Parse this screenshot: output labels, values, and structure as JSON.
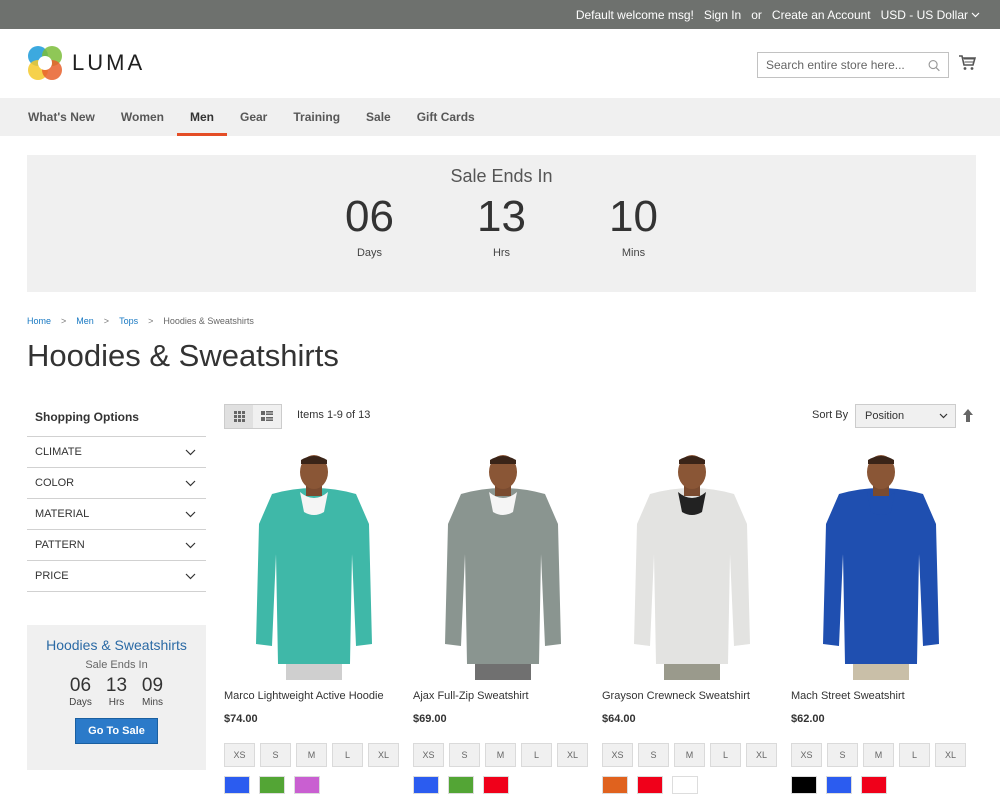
{
  "topbar": {
    "welcome": "Default welcome msg!",
    "sign_in": "Sign In",
    "or": "or",
    "create_account": "Create an Account",
    "currency": "USD - US Dollar"
  },
  "header": {
    "logo_text": "LUMA",
    "search_placeholder": "Search entire store here..."
  },
  "nav": {
    "items": [
      {
        "label": "What's New"
      },
      {
        "label": "Women"
      },
      {
        "label": "Men",
        "active": true
      },
      {
        "label": "Gear"
      },
      {
        "label": "Training"
      },
      {
        "label": "Sale"
      },
      {
        "label": "Gift Cards"
      }
    ]
  },
  "banner": {
    "title": "Sale Ends In",
    "days": "06",
    "days_label": "Days",
    "hrs": "13",
    "hrs_label": "Hrs",
    "mins": "10",
    "mins_label": "Mins"
  },
  "breadcrumbs": [
    "Home",
    "Men",
    "Tops",
    "Hoodies & Sweatshirts"
  ],
  "page_title": "Hoodies & Sweatshirts",
  "sidebar": {
    "title": "Shopping Options",
    "filters": [
      "Climate",
      "Color",
      "Material",
      "Pattern",
      "Price"
    ]
  },
  "mini_sale": {
    "title": "Hoodies & Sweatshirts",
    "subtitle": "Sale Ends In",
    "days": "06",
    "days_label": "Days",
    "hrs": "13",
    "hrs_label": "Hrs",
    "mins": "09",
    "mins_label": "Mins",
    "button": "Go To Sale"
  },
  "toolbar": {
    "amount": "Items 1-9 of 13",
    "sort_label": "Sort By",
    "sort_value": "Position"
  },
  "products": [
    {
      "name": "Marco Lightweight Active Hoodie",
      "price": "$74.00",
      "sizes": [
        "XS",
        "S",
        "M",
        "L",
        "XL"
      ],
      "colors": [
        "#2b5cf0",
        "#53a535",
        "#c95fd1"
      ],
      "shirt": "#3fb8a8",
      "accent": "#f5f5f5",
      "pants": "#cfcfcf"
    },
    {
      "name": "Ajax Full-Zip Sweatshirt",
      "price": "$69.00",
      "sizes": [
        "XS",
        "S",
        "M",
        "L",
        "XL"
      ],
      "colors": [
        "#2b5cf0",
        "#53a535",
        "#f0001a"
      ],
      "shirt": "#8a9590",
      "accent": "#f5f5f5",
      "pants": "#707070"
    },
    {
      "name": "Grayson Crewneck Sweatshirt",
      "price": "$64.00",
      "sizes": [
        "XS",
        "S",
        "M",
        "L",
        "XL"
      ],
      "colors": [
        "#e0621e",
        "#f0001a",
        "#ffffff"
      ],
      "shirt": "#e3e3e1",
      "accent": "#222222",
      "pants": "#9a9a8c"
    },
    {
      "name": "Mach Street Sweatshirt",
      "price": "$62.00",
      "sizes": [
        "XS",
        "S",
        "M",
        "L",
        "XL"
      ],
      "colors": [
        "#000000",
        "#2b5cf0",
        "#f0001a"
      ],
      "shirt": "#1f4fb0",
      "accent": "#1f4fb0",
      "pants": "#c9bfa8"
    }
  ],
  "colors": {
    "topbar_bg": "#6e716e",
    "nav_active_underline": "#e44d26",
    "link": "#1979c3",
    "button": "#2b7ac9"
  }
}
